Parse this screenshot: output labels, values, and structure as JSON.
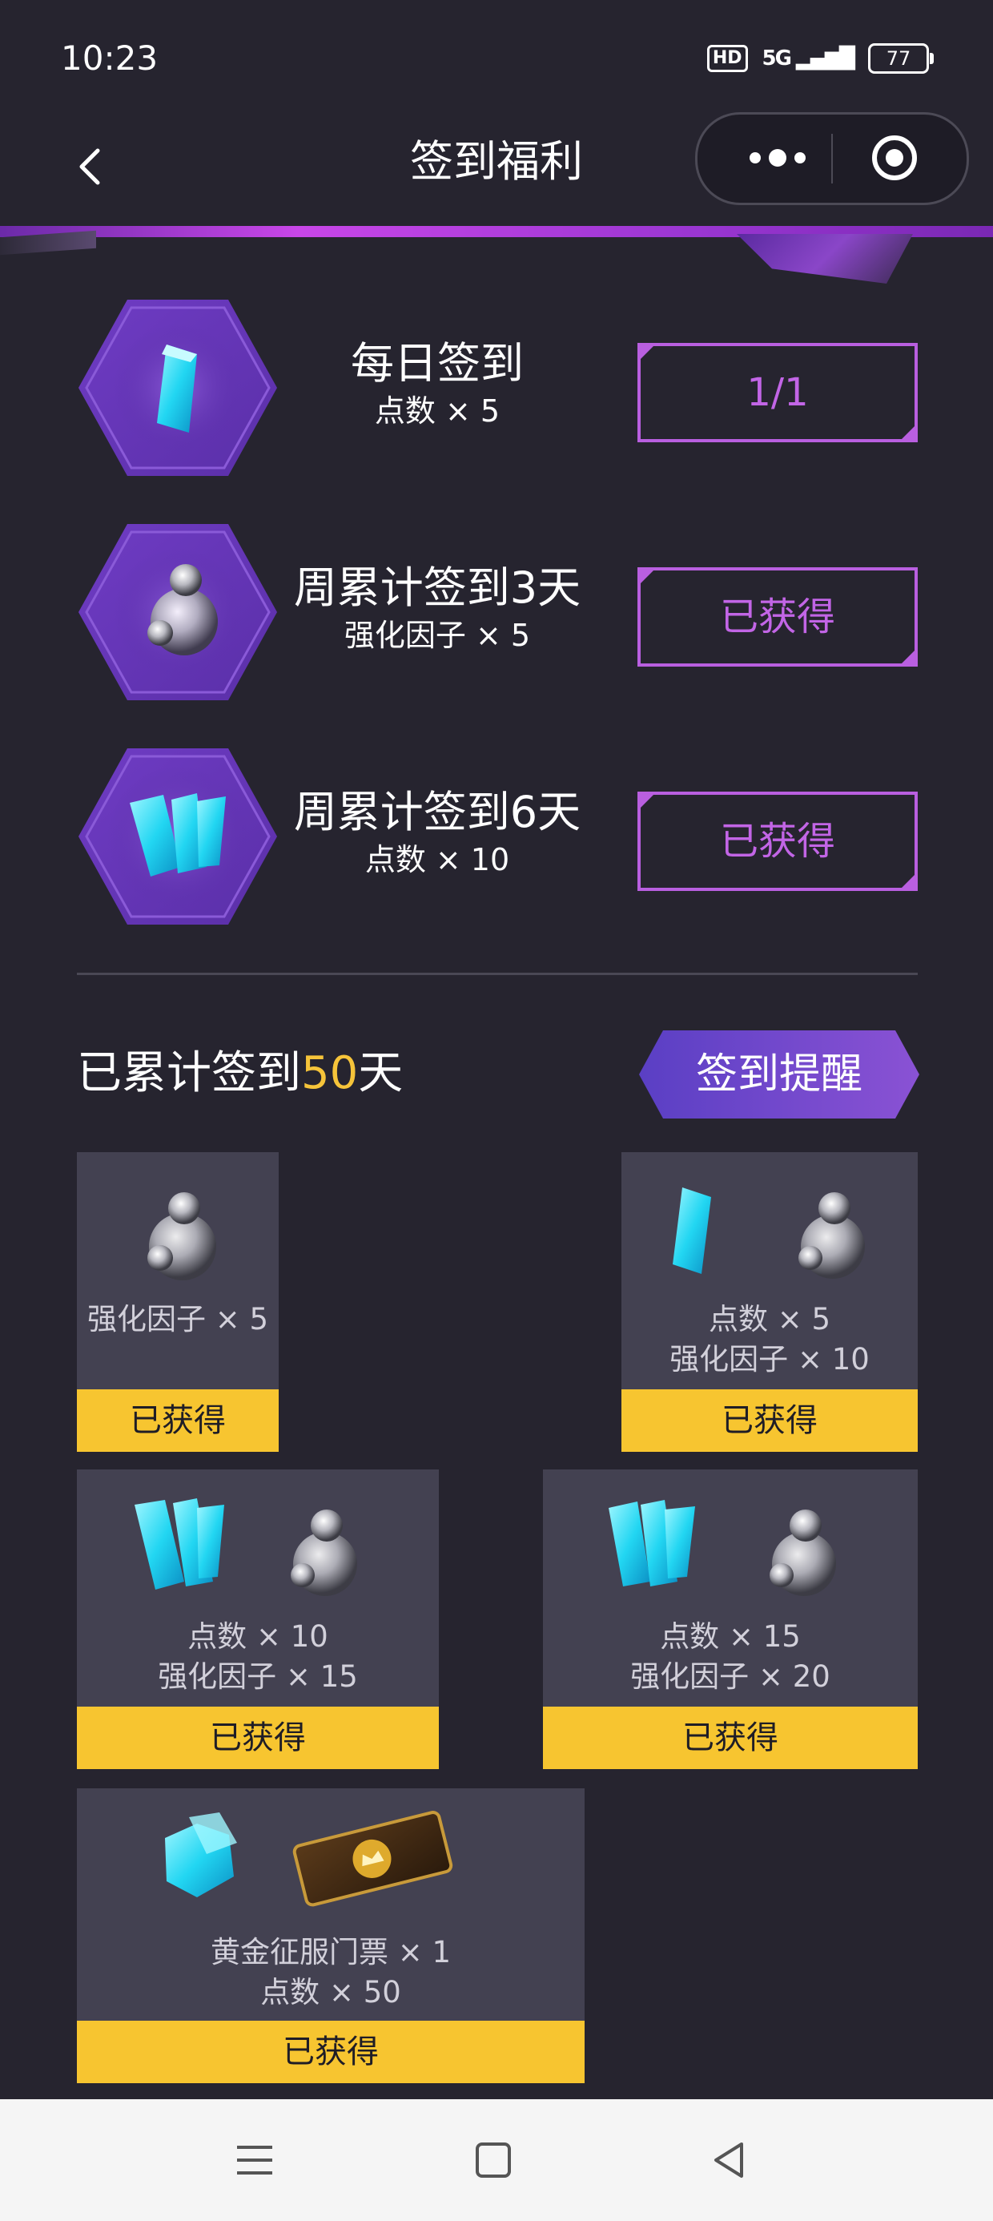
{
  "status": {
    "time": "10:23",
    "hd": "HD",
    "signal": "5G",
    "battery": "77"
  },
  "nav": {
    "title": "签到福利"
  },
  "daily_rewards": [
    {
      "title": "每日签到",
      "reward": "点数 × 5",
      "button": "1/1",
      "icon": "crystal-shard-icon"
    },
    {
      "title": "周累计签到3天",
      "reward": "强化因子 × 5",
      "button": "已获得",
      "icon": "pearl-orb-icon"
    },
    {
      "title": "周累计签到6天",
      "reward": "点数 × 10",
      "button": "已获得",
      "icon": "crystal-cluster-icon"
    }
  ],
  "cumulative": {
    "prefix": "已累计签到",
    "days": "50",
    "suffix": "天",
    "remind_button": "签到提醒"
  },
  "milestone_cards": [
    {
      "lines": [
        "强化因子 × 5"
      ],
      "status": "已获得"
    },
    {
      "lines": [
        "点数 × 5",
        "强化因子 × 10"
      ],
      "status": "已获得"
    },
    {
      "lines": [
        "点数 × 10",
        "强化因子 × 15"
      ],
      "status": "已获得"
    },
    {
      "lines": [
        "点数 × 15",
        "强化因子 × 20"
      ],
      "status": "已获得"
    },
    {
      "lines": [
        "黄金征服门票 × 1",
        "点数 × 50"
      ],
      "status": "已获得"
    }
  ],
  "colors": {
    "accent_purple": "#c265e6",
    "gold": "#f7c530",
    "number_highlight": "#f6c43a",
    "background": "#26242f"
  },
  "system_nav": [
    "menu-icon",
    "home-square-icon",
    "back-triangle-icon"
  ]
}
